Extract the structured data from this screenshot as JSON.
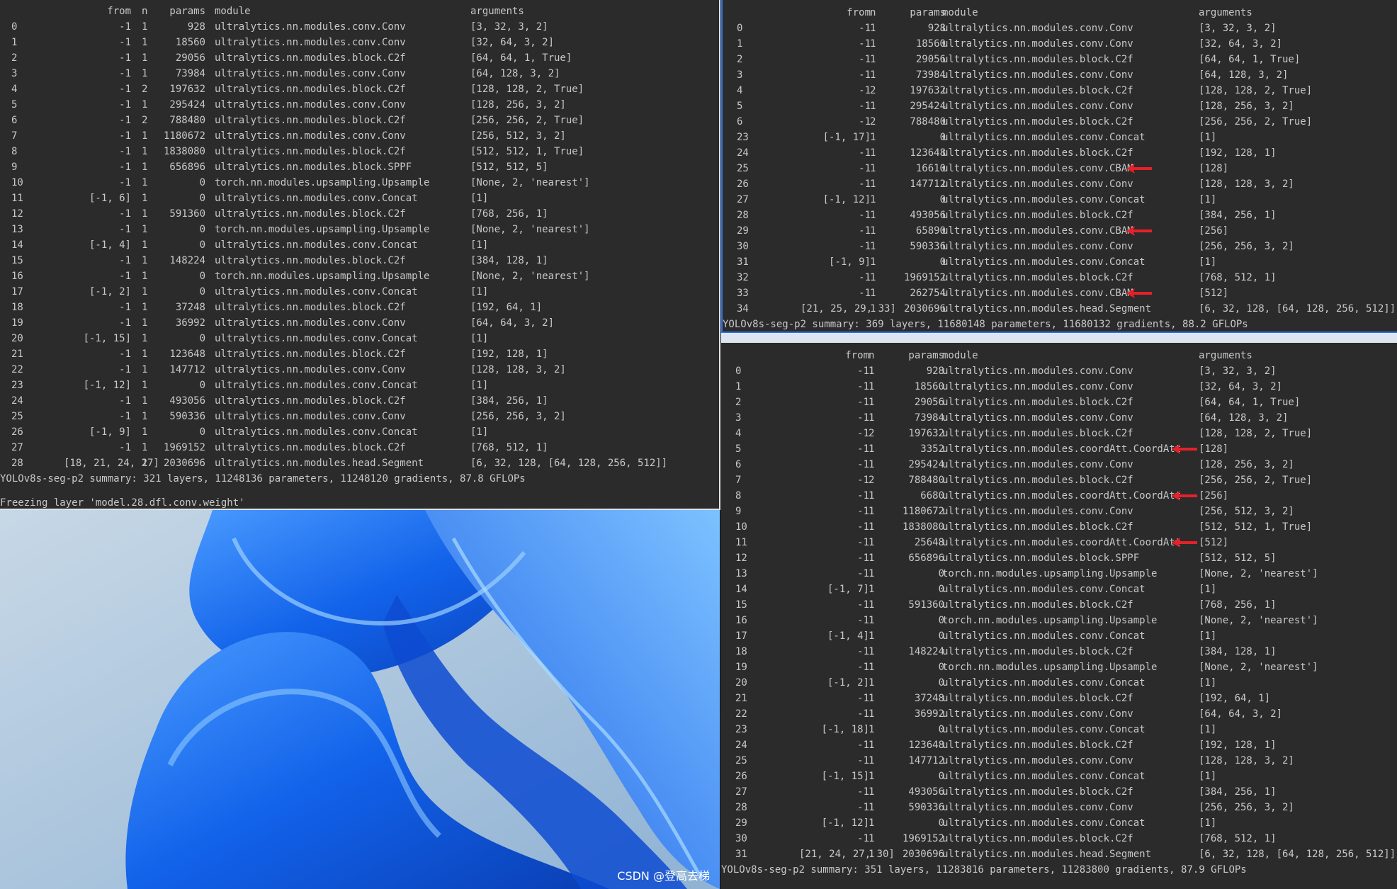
{
  "left": {
    "headers": {
      "from": "from",
      "n": "n",
      "params": "params",
      "module": "module",
      "arguments": "arguments"
    },
    "rows": [
      [
        "0",
        "-1",
        "1",
        "928",
        "ultralytics.nn.modules.conv.Conv",
        "[3, 32, 3, 2]"
      ],
      [
        "1",
        "-1",
        "1",
        "18560",
        "ultralytics.nn.modules.conv.Conv",
        "[32, 64, 3, 2]"
      ],
      [
        "2",
        "-1",
        "1",
        "29056",
        "ultralytics.nn.modules.block.C2f",
        "[64, 64, 1, True]"
      ],
      [
        "3",
        "-1",
        "1",
        "73984",
        "ultralytics.nn.modules.conv.Conv",
        "[64, 128, 3, 2]"
      ],
      [
        "4",
        "-1",
        "2",
        "197632",
        "ultralytics.nn.modules.block.C2f",
        "[128, 128, 2, True]"
      ],
      [
        "5",
        "-1",
        "1",
        "295424",
        "ultralytics.nn.modules.conv.Conv",
        "[128, 256, 3, 2]"
      ],
      [
        "6",
        "-1",
        "2",
        "788480",
        "ultralytics.nn.modules.block.C2f",
        "[256, 256, 2, True]"
      ],
      [
        "7",
        "-1",
        "1",
        "1180672",
        "ultralytics.nn.modules.conv.Conv",
        "[256, 512, 3, 2]"
      ],
      [
        "8",
        "-1",
        "1",
        "1838080",
        "ultralytics.nn.modules.block.C2f",
        "[512, 512, 1, True]"
      ],
      [
        "9",
        "-1",
        "1",
        "656896",
        "ultralytics.nn.modules.block.SPPF",
        "[512, 512, 5]"
      ],
      [
        "10",
        "-1",
        "1",
        "0",
        "torch.nn.modules.upsampling.Upsample",
        "[None, 2, 'nearest']"
      ],
      [
        "11",
        "[-1, 6]",
        "1",
        "0",
        "ultralytics.nn.modules.conv.Concat",
        "[1]"
      ],
      [
        "12",
        "-1",
        "1",
        "591360",
        "ultralytics.nn.modules.block.C2f",
        "[768, 256, 1]"
      ],
      [
        "13",
        "-1",
        "1",
        "0",
        "torch.nn.modules.upsampling.Upsample",
        "[None, 2, 'nearest']"
      ],
      [
        "14",
        "[-1, 4]",
        "1",
        "0",
        "ultralytics.nn.modules.conv.Concat",
        "[1]"
      ],
      [
        "15",
        "-1",
        "1",
        "148224",
        "ultralytics.nn.modules.block.C2f",
        "[384, 128, 1]"
      ],
      [
        "16",
        "-1",
        "1",
        "0",
        "torch.nn.modules.upsampling.Upsample",
        "[None, 2, 'nearest']"
      ],
      [
        "17",
        "[-1, 2]",
        "1",
        "0",
        "ultralytics.nn.modules.conv.Concat",
        "[1]"
      ],
      [
        "18",
        "-1",
        "1",
        "37248",
        "ultralytics.nn.modules.block.C2f",
        "[192, 64, 1]"
      ],
      [
        "19",
        "-1",
        "1",
        "36992",
        "ultralytics.nn.modules.conv.Conv",
        "[64, 64, 3, 2]"
      ],
      [
        "20",
        "[-1, 15]",
        "1",
        "0",
        "ultralytics.nn.modules.conv.Concat",
        "[1]"
      ],
      [
        "21",
        "-1",
        "1",
        "123648",
        "ultralytics.nn.modules.block.C2f",
        "[192, 128, 1]"
      ],
      [
        "22",
        "-1",
        "1",
        "147712",
        "ultralytics.nn.modules.conv.Conv",
        "[128, 128, 3, 2]"
      ],
      [
        "23",
        "[-1, 12]",
        "1",
        "0",
        "ultralytics.nn.modules.conv.Concat",
        "[1]"
      ],
      [
        "24",
        "-1",
        "1",
        "493056",
        "ultralytics.nn.modules.block.C2f",
        "[384, 256, 1]"
      ],
      [
        "25",
        "-1",
        "1",
        "590336",
        "ultralytics.nn.modules.conv.Conv",
        "[256, 256, 3, 2]"
      ],
      [
        "26",
        "[-1, 9]",
        "1",
        "0",
        "ultralytics.nn.modules.conv.Concat",
        "[1]"
      ],
      [
        "27",
        "-1",
        "1",
        "1969152",
        "ultralytics.nn.modules.block.C2f",
        "[768, 512, 1]"
      ],
      [
        "28",
        "[18, 21, 24, 27]",
        "1",
        "2030696",
        "ultralytics.nn.modules.head.Segment",
        "[6, 32, 128, [64, 128, 256, 512]]"
      ]
    ],
    "summary": "YOLOv8s-seg-p2 summary: 321 layers, 11248136 parameters, 11248120 gradients, 87.8 GFLOPs",
    "cut_line": "Freezing layer 'model.28.dfl.conv.weight'"
  },
  "top_right": {
    "headers": {
      "from": "from",
      "n": "n",
      "params": "params",
      "module": "module",
      "arguments": "arguments"
    },
    "rows": [
      [
        "0",
        "-1",
        "1",
        "928",
        "ultralytics.nn.modules.conv.Conv",
        "[3, 32, 3, 2]"
      ],
      [
        "1",
        "-1",
        "1",
        "18560",
        "ultralytics.nn.modules.conv.Conv",
        "[32, 64, 3, 2]"
      ],
      [
        "2",
        "-1",
        "1",
        "29056",
        "ultralytics.nn.modules.block.C2f",
        "[64, 64, 1, True]"
      ],
      [
        "3",
        "-1",
        "1",
        "73984",
        "ultralytics.nn.modules.conv.Conv",
        "[64, 128, 3, 2]"
      ],
      [
        "4",
        "-1",
        "2",
        "197632",
        "ultralytics.nn.modules.block.C2f",
        "[128, 128, 2, True]"
      ],
      [
        "5",
        "-1",
        "1",
        "295424",
        "ultralytics.nn.modules.conv.Conv",
        "[128, 256, 3, 2]"
      ],
      [
        "6",
        "-1",
        "2",
        "788480",
        "ultralytics.nn.modules.block.C2f",
        "[256, 256, 2, True]"
      ],
      [
        "23",
        "[-1, 17]",
        "1",
        "0",
        "ultralytics.nn.modules.conv.Concat",
        "[1]"
      ],
      [
        "24",
        "-1",
        "1",
        "123648",
        "ultralytics.nn.modules.block.C2f",
        "[192, 128, 1]"
      ],
      [
        "25",
        "-1",
        "1",
        "16610",
        "ultralytics.nn.modules.conv.CBAM",
        "[128]"
      ],
      [
        "26",
        "-1",
        "1",
        "147712",
        "ultralytics.nn.modules.conv.Conv",
        "[128, 128, 3, 2]"
      ],
      [
        "27",
        "[-1, 12]",
        "1",
        "0",
        "ultralytics.nn.modules.conv.Concat",
        "[1]"
      ],
      [
        "28",
        "-1",
        "1",
        "493056",
        "ultralytics.nn.modules.block.C2f",
        "[384, 256, 1]"
      ],
      [
        "29",
        "-1",
        "1",
        "65890",
        "ultralytics.nn.modules.conv.CBAM",
        "[256]"
      ],
      [
        "30",
        "-1",
        "1",
        "590336",
        "ultralytics.nn.modules.conv.Conv",
        "[256, 256, 3, 2]"
      ],
      [
        "31",
        "[-1, 9]",
        "1",
        "0",
        "ultralytics.nn.modules.conv.Concat",
        "[1]"
      ],
      [
        "32",
        "-1",
        "1",
        "1969152",
        "ultralytics.nn.modules.block.C2f",
        "[768, 512, 1]"
      ],
      [
        "33",
        "-1",
        "1",
        "262754",
        "ultralytics.nn.modules.conv.CBAM",
        "[512]"
      ],
      [
        "34",
        "[21, 25, 29, 33]",
        "1",
        "2030696",
        "ultralytics.nn.modules.head.Segment",
        "[6, 32, 128, [64, 128, 256, 512]]"
      ]
    ],
    "arrow_rows": [
      9,
      13,
      17
    ],
    "summary": "YOLOv8s-seg-p2 summary: 369 layers, 11680148 parameters, 11680132 gradients, 88.2 GFLOPs"
  },
  "bottom_right": {
    "headers": {
      "from": "from",
      "n": "n",
      "params": "params",
      "module": "module",
      "arguments": "arguments"
    },
    "rows": [
      [
        "0",
        "-1",
        "1",
        "928",
        "ultralytics.nn.modules.conv.Conv",
        "[3, 32, 3, 2]"
      ],
      [
        "1",
        "-1",
        "1",
        "18560",
        "ultralytics.nn.modules.conv.Conv",
        "[32, 64, 3, 2]"
      ],
      [
        "2",
        "-1",
        "1",
        "29056",
        "ultralytics.nn.modules.block.C2f",
        "[64, 64, 1, True]"
      ],
      [
        "3",
        "-1",
        "1",
        "73984",
        "ultralytics.nn.modules.conv.Conv",
        "[64, 128, 3, 2]"
      ],
      [
        "4",
        "-1",
        "2",
        "197632",
        "ultralytics.nn.modules.block.C2f",
        "[128, 128, 2, True]"
      ],
      [
        "5",
        "-1",
        "1",
        "3352",
        "ultralytics.nn.modules.coordAtt.CoordAtt",
        "[128]"
      ],
      [
        "6",
        "-1",
        "1",
        "295424",
        "ultralytics.nn.modules.conv.Conv",
        "[128, 256, 3, 2]"
      ],
      [
        "7",
        "-1",
        "2",
        "788480",
        "ultralytics.nn.modules.block.C2f",
        "[256, 256, 2, True]"
      ],
      [
        "8",
        "-1",
        "1",
        "6680",
        "ultralytics.nn.modules.coordAtt.CoordAtt",
        "[256]"
      ],
      [
        "9",
        "-1",
        "1",
        "1180672",
        "ultralytics.nn.modules.conv.Conv",
        "[256, 512, 3, 2]"
      ],
      [
        "10",
        "-1",
        "1",
        "1838080",
        "ultralytics.nn.modules.block.C2f",
        "[512, 512, 1, True]"
      ],
      [
        "11",
        "-1",
        "1",
        "25648",
        "ultralytics.nn.modules.coordAtt.CoordAtt",
        "[512]"
      ],
      [
        "12",
        "-1",
        "1",
        "656896",
        "ultralytics.nn.modules.block.SPPF",
        "[512, 512, 5]"
      ],
      [
        "13",
        "-1",
        "1",
        "0",
        "torch.nn.modules.upsampling.Upsample",
        "[None, 2, 'nearest']"
      ],
      [
        "14",
        "[-1, 7]",
        "1",
        "0",
        "ultralytics.nn.modules.conv.Concat",
        "[1]"
      ],
      [
        "15",
        "-1",
        "1",
        "591360",
        "ultralytics.nn.modules.block.C2f",
        "[768, 256, 1]"
      ],
      [
        "16",
        "-1",
        "1",
        "0",
        "torch.nn.modules.upsampling.Upsample",
        "[None, 2, 'nearest']"
      ],
      [
        "17",
        "[-1, 4]",
        "1",
        "0",
        "ultralytics.nn.modules.conv.Concat",
        "[1]"
      ],
      [
        "18",
        "-1",
        "1",
        "148224",
        "ultralytics.nn.modules.block.C2f",
        "[384, 128, 1]"
      ],
      [
        "19",
        "-1",
        "1",
        "0",
        "torch.nn.modules.upsampling.Upsample",
        "[None, 2, 'nearest']"
      ],
      [
        "20",
        "[-1, 2]",
        "1",
        "0",
        "ultralytics.nn.modules.conv.Concat",
        "[1]"
      ],
      [
        "21",
        "-1",
        "1",
        "37248",
        "ultralytics.nn.modules.block.C2f",
        "[192, 64, 1]"
      ],
      [
        "22",
        "-1",
        "1",
        "36992",
        "ultralytics.nn.modules.conv.Conv",
        "[64, 64, 3, 2]"
      ],
      [
        "23",
        "[-1, 18]",
        "1",
        "0",
        "ultralytics.nn.modules.conv.Concat",
        "[1]"
      ],
      [
        "24",
        "-1",
        "1",
        "123648",
        "ultralytics.nn.modules.block.C2f",
        "[192, 128, 1]"
      ],
      [
        "25",
        "-1",
        "1",
        "147712",
        "ultralytics.nn.modules.conv.Conv",
        "[128, 128, 3, 2]"
      ],
      [
        "26",
        "[-1, 15]",
        "1",
        "0",
        "ultralytics.nn.modules.conv.Concat",
        "[1]"
      ],
      [
        "27",
        "-1",
        "1",
        "493056",
        "ultralytics.nn.modules.block.C2f",
        "[384, 256, 1]"
      ],
      [
        "28",
        "-1",
        "1",
        "590336",
        "ultralytics.nn.modules.conv.Conv",
        "[256, 256, 3, 2]"
      ],
      [
        "29",
        "[-1, 12]",
        "1",
        "0",
        "ultralytics.nn.modules.conv.Concat",
        "[1]"
      ],
      [
        "30",
        "-1",
        "1",
        "1969152",
        "ultralytics.nn.modules.block.C2f",
        "[768, 512, 1]"
      ],
      [
        "31",
        "[21, 24, 27, 30]",
        "1",
        "2030696",
        "ultralytics.nn.modules.head.Segment",
        "[6, 32, 128, [64, 128, 256, 512]]"
      ]
    ],
    "arrow_rows": [
      5,
      8,
      11
    ],
    "summary": "YOLOv8s-seg-p2 summary: 351 layers, 11283816 parameters, 11283800 gradients, 87.9 GFLOPs"
  },
  "watermark": "CSDN @登高去梯",
  "colors": {
    "terminal_bg": "#2b2b2b",
    "text": "#c8c8c8",
    "arrow": "#e8202a",
    "wallpaper_blue": "#1f6bf0"
  }
}
